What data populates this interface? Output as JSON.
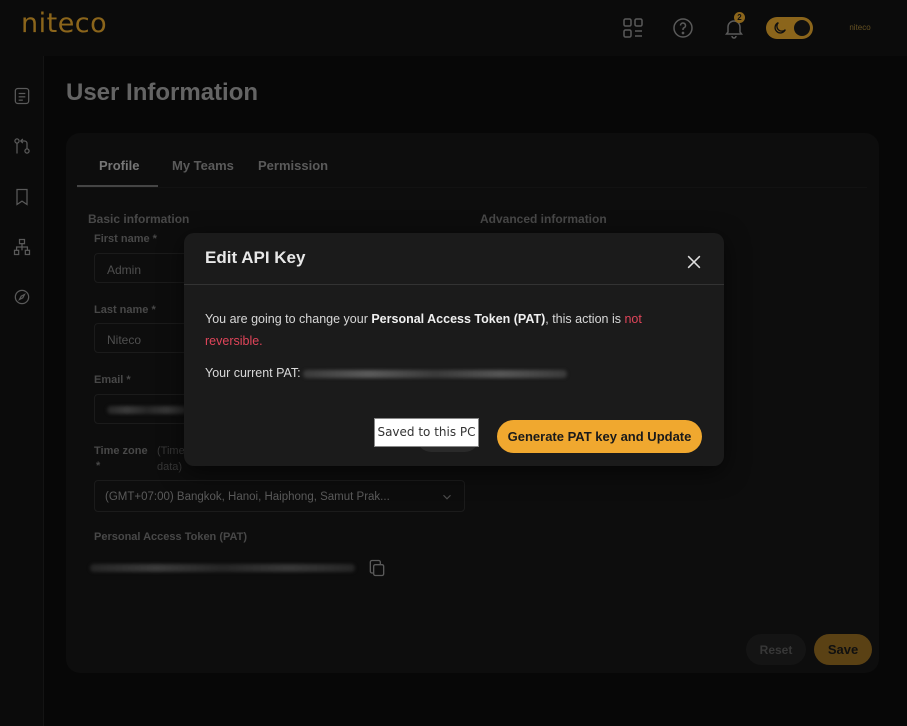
{
  "app": {
    "logo": "niteco",
    "notification_count": "2",
    "avatar_text": "niteco"
  },
  "page": {
    "title": "User Information"
  },
  "tabs": [
    {
      "label": "Profile"
    },
    {
      "label": "My Teams"
    },
    {
      "label": "Permission"
    }
  ],
  "form": {
    "basic_title": "Basic information",
    "advanced_title": "Advanced information",
    "first_name_label": "First name *",
    "first_name_value": "Admin",
    "last_name_label": "Last name *",
    "last_name_value": "Niteco",
    "email_label": "Email *",
    "timezone_label": "Time zone",
    "timezone_hint_line1": "(Time",
    "timezone_hint_line2": "data)",
    "timezone_value": "(GMT+07:00) Bangkok, Hanoi, Haiphong, Samut Prak...",
    "pat_label": "Personal Access Token (PAT)",
    "reset_label": "Reset",
    "save_label": "Save"
  },
  "modal": {
    "title": "Edit API Key",
    "text_prefix": "You are going to change your ",
    "text_bold": "Personal Access Token (PAT)",
    "text_mid": ", this action is ",
    "text_danger": "not reversible.",
    "current_pat_label": "Your current PAT:",
    "tooltip": "Saved to this PC",
    "generate_label": "Generate PAT key and Update"
  },
  "colors": {
    "accent": "#f0a82f",
    "danger": "#e0455a",
    "background": "#0b0b0b"
  }
}
